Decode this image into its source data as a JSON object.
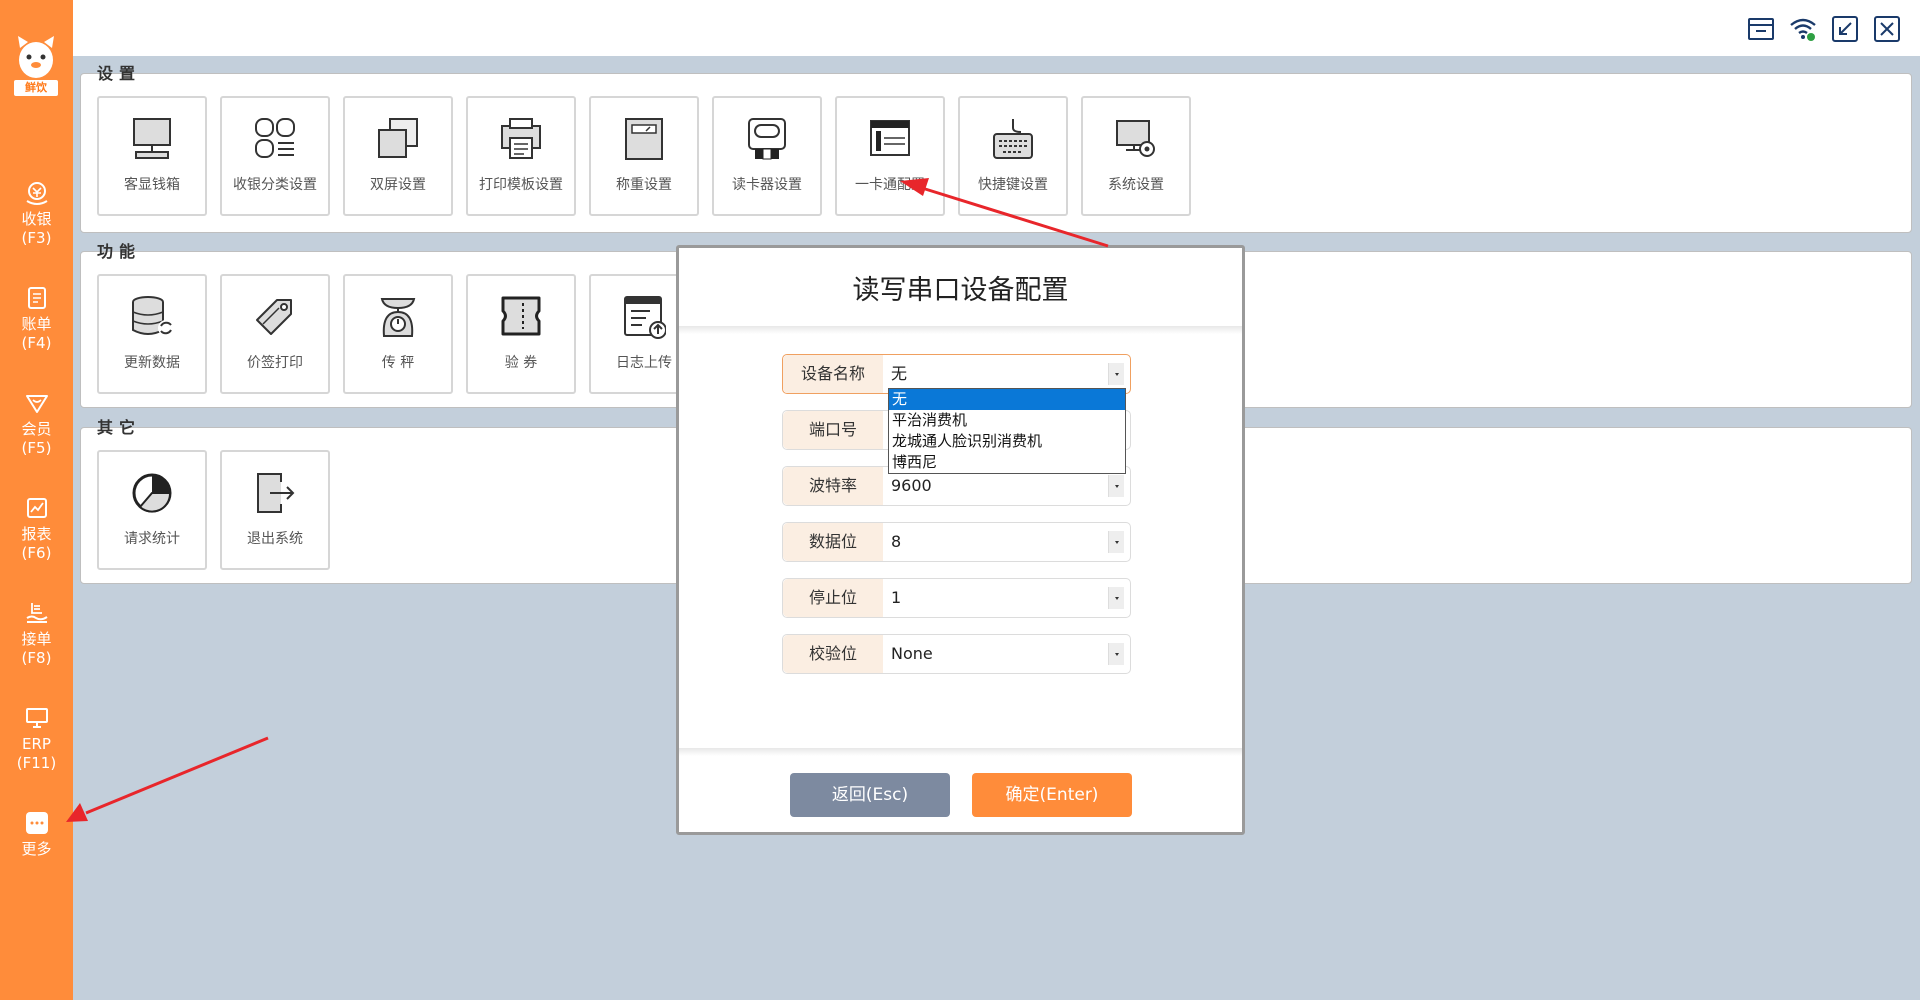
{
  "sidebar": {
    "logo_text": "鲜饮",
    "items": [
      {
        "label": "收银",
        "key": "(F3)"
      },
      {
        "label": "账单",
        "key": "(F4)"
      },
      {
        "label": "会员",
        "key": "(F5)"
      },
      {
        "label": "报表",
        "key": "(F6)"
      },
      {
        "label": "接单",
        "key": "(F8)"
      },
      {
        "label": "ERP",
        "key": "(F11)"
      },
      {
        "label": "更多",
        "key": ""
      }
    ]
  },
  "topbar": {
    "icons": [
      "cash-drawer-icon",
      "wifi-icon",
      "minimize-icon",
      "close-icon"
    ]
  },
  "groups": {
    "settings": {
      "title": "设置",
      "tiles": [
        "客显钱箱",
        "收银分类设置",
        "双屏设置",
        "打印模板设置",
        "称重设置",
        "读卡器设置",
        "一卡通配置",
        "快捷键设置",
        "系统设置"
      ]
    },
    "functions": {
      "title": "功能",
      "tiles": [
        "更新数据",
        "价签打印",
        "传 秤",
        "验 券",
        "日志上传"
      ]
    },
    "others": {
      "title": "其它",
      "tiles": [
        "请求统计",
        "退出系统"
      ]
    }
  },
  "modal": {
    "title": "读写串口设备配置",
    "fields": [
      {
        "label": "设备名称",
        "value": "无"
      },
      {
        "label": "端口号",
        "value": ""
      },
      {
        "label": "波特率",
        "value": "9600"
      },
      {
        "label": "数据位",
        "value": "8"
      },
      {
        "label": "停止位",
        "value": "1"
      },
      {
        "label": "校验位",
        "value": "None"
      }
    ],
    "dropdown_options": [
      "无",
      "平治消费机",
      "龙城通人脸识别消费机",
      "博西尼"
    ],
    "back_button": "返回(Esc)",
    "ok_button": "确定(Enter)"
  },
  "colors": {
    "accent": "#ff8c3a",
    "background": "#c3cfdb",
    "selected": "#0a78d7",
    "arrow": "#e8262b"
  }
}
